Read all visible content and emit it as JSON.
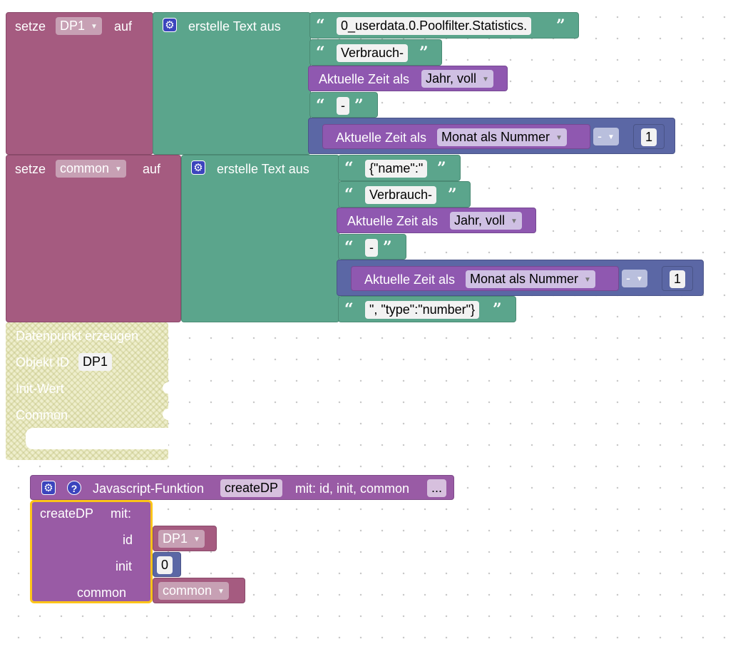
{
  "block1": {
    "set_label": "setze",
    "var": "DP1",
    "to_label": "auf",
    "join_label": "erstelle Text aus",
    "text1": "0_userdata.0.Poolfilter.Statistics.",
    "text2": "Verbrauch-",
    "time_label_a": "Aktuelle Zeit als",
    "time_opt_a": "Jahr, voll",
    "text3": "-",
    "time_label_b": "Aktuelle Zeit als",
    "time_opt_b": "Monat als Nummer",
    "op": "-",
    "num": "1"
  },
  "block2": {
    "set_label": "setze",
    "var": "common",
    "to_label": "auf",
    "join_label": "erstelle Text aus",
    "text1": "{\"name\":\"",
    "text2": "Verbrauch-",
    "time_label_a": "Aktuelle Zeit als",
    "time_opt_a": "Jahr, voll",
    "text3": "-",
    "time_label_b": "Aktuelle Zeit als",
    "time_opt_b": "Monat als Nummer",
    "op": "-",
    "num": "1",
    "text4": "\", \"type\":\"number\"}"
  },
  "ghost_block": {
    "title": "Datenpunkt erzeugen",
    "obj_label": "Objekt ID",
    "obj_value": "DP1",
    "init_label": "Init-Wert",
    "common_label": "Common"
  },
  "function_block": {
    "label": "Javascript-Funktion",
    "name": "createDP",
    "with_label": "mit: id, init, common",
    "more": "...",
    "call_name": "createDP",
    "call_with": "mit:",
    "param_id": "id",
    "param_id_value": "DP1",
    "param_init": "init",
    "param_init_value": "0",
    "param_common": "common",
    "param_common_value": "common"
  },
  "colors": {
    "variable": "#a55b80",
    "text": "#5ba58c",
    "date": "#8f58b0",
    "math": "#5b67a5",
    "function": "#995ba5",
    "selected_outline": "#fcc419"
  },
  "icons": [
    "gear-icon",
    "help-icon",
    "dropdown-arrow-icon",
    "open-quote-icon",
    "close-quote-icon"
  ]
}
